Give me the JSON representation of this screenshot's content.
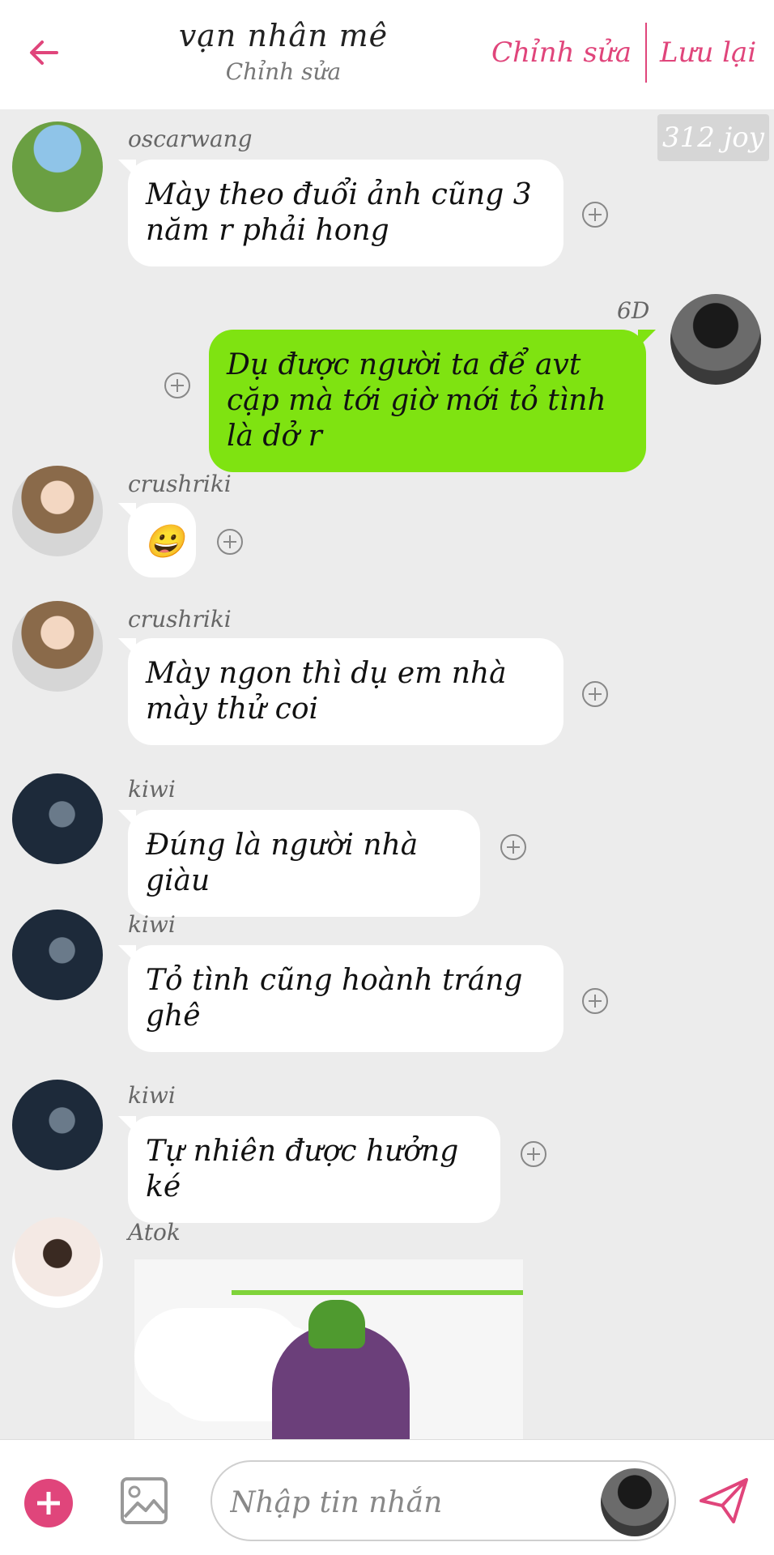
{
  "header": {
    "title": "vạn nhân mê",
    "subtitle": "Chỉnh sửa",
    "edit_label": "Chỉnh sửa",
    "save_label": "Lưu lại"
  },
  "watermark": "312 joy",
  "messages": [
    {
      "sender": "oscarwang",
      "text": "Mày theo đuổi ảnh cũng 3 năm r phải hong"
    },
    {
      "sender": "6D",
      "text": "Dụ được người ta để avt cặp mà tới giờ mới tỏ tình là dở r"
    },
    {
      "sender": "crushriki",
      "text": "😀"
    },
    {
      "sender": "crushriki",
      "text": "Mày ngon thì dụ em nhà mày thử coi"
    },
    {
      "sender": "kiwi",
      "text": "Đúng là người nhà giàu"
    },
    {
      "sender": "kiwi",
      "text": "Tỏ tình cũng hoành tráng ghê"
    },
    {
      "sender": "kiwi",
      "text": "Tự nhiên được hưởng ké"
    },
    {
      "sender": "Atok",
      "text": ""
    }
  ],
  "composer": {
    "placeholder": "Nhập tin nhắn"
  },
  "colors": {
    "accent": "#e0457b",
    "my_bubble": "#7fe311",
    "background": "#ececec"
  },
  "icons": [
    "back-arrow-icon",
    "plus-circle-icon",
    "add-icon",
    "image-icon",
    "send-icon"
  ]
}
